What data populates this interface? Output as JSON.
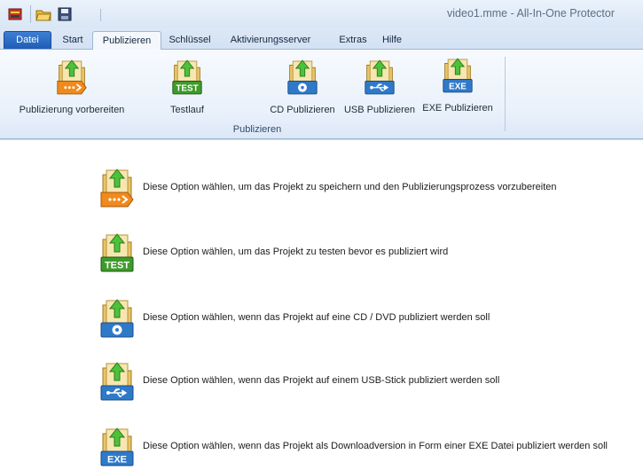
{
  "window": {
    "title": "video1.mme - All-In-One Protector"
  },
  "quick_access": [
    "app-icon",
    "open-folder-icon",
    "save-icon"
  ],
  "tabs": [
    {
      "label": "Datei",
      "state": "file"
    },
    {
      "label": "Start",
      "state": "normal"
    },
    {
      "label": "Publizieren",
      "state": "active"
    },
    {
      "label": "Schlüssel",
      "state": "normal"
    },
    {
      "label": "Aktivierungsserver",
      "state": "normal"
    },
    {
      "label": "Extras",
      "state": "normal"
    },
    {
      "label": "Hilfe",
      "state": "normal"
    }
  ],
  "ribbon": {
    "group_label": "Publizieren",
    "buttons": [
      {
        "label": "Publizierung vorbereiten",
        "badge": "",
        "icon": "prepare-publish-icon"
      },
      {
        "label": "Testlauf",
        "badge": "TEST",
        "icon": "test-run-icon"
      },
      {
        "label": "CD Publizieren",
        "badge": "",
        "icon": "cd-publish-icon"
      },
      {
        "label": "USB Publizieren",
        "badge": "",
        "icon": "usb-publish-icon"
      },
      {
        "label": "EXE Publizieren",
        "badge": "EXE",
        "icon": "exe-publish-icon"
      }
    ]
  },
  "options": [
    {
      "text": "Diese Option wählen, um das Projekt zu speichern und den Publizierungsprozess vorzubereiten",
      "badge": ""
    },
    {
      "text": "Diese Option wählen, um das Projekt zu testen bevor es publiziert wird",
      "badge": "TEST"
    },
    {
      "text": "Diese Option wählen, wenn das Projekt auf eine CD / DVD publiziert werden soll",
      "badge": ""
    },
    {
      "text": "Diese Option wählen, wenn das Projekt auf einem USB-Stick publiziert werden soll",
      "badge": ""
    },
    {
      "text": "Diese Option wählen, wenn das Projekt als Downloadversion in Form einer EXE Datei publiziert werden soll",
      "badge": "EXE"
    }
  ],
  "colors": {
    "prepare": "#f08a1c",
    "test": "#3f9a2c",
    "cd": "#2f79c9",
    "usb": "#2f79c9",
    "exe": "#2f79c9",
    "arrow": "#4cc23a"
  }
}
